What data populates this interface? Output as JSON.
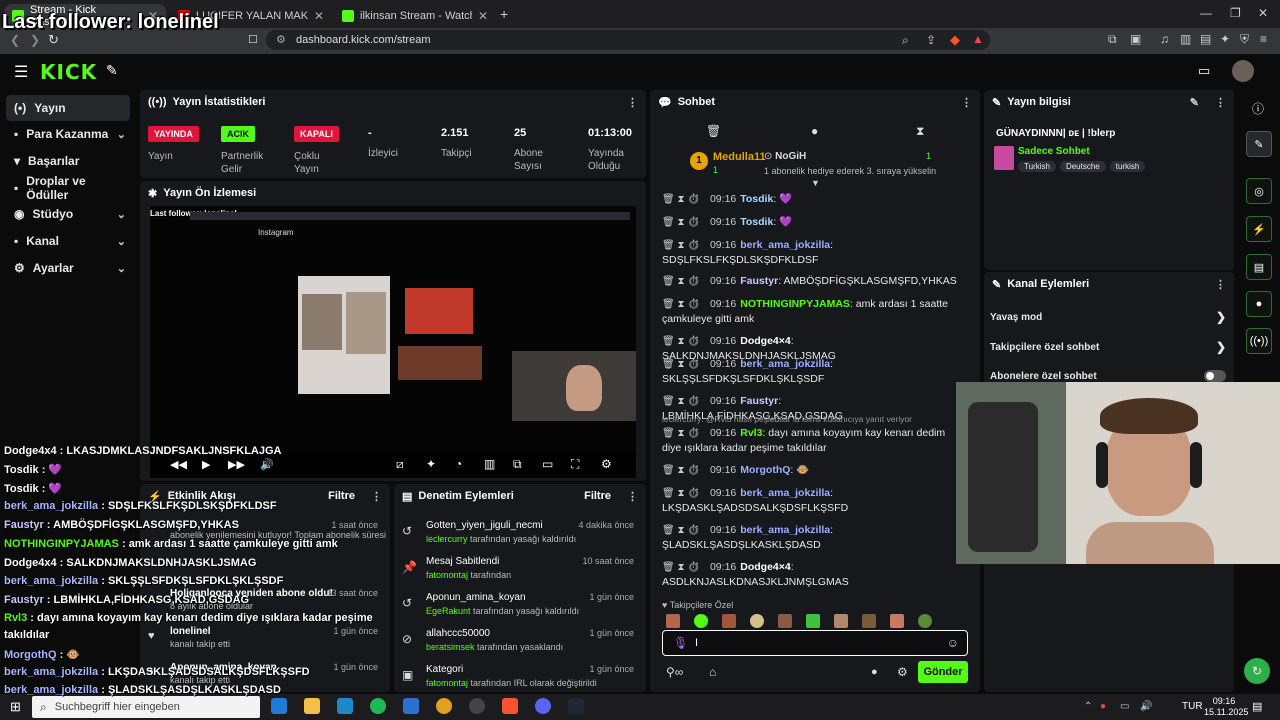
{
  "browser": {
    "tabs": [
      {
        "title": "Stream - Kick Dashboard",
        "active": true
      },
      {
        "title": "LUCIFER YALAN MAKİNESİNDE! | #Pe...",
        "active": false
      },
      {
        "title": "ilkinsan Stream - Watch Live on Kick",
        "active": false
      }
    ],
    "url": "dashboard.kick.com/stream"
  },
  "overlay": {
    "last_follower": "Last follower: lonelinel",
    "chat": [
      {
        "user": "Dodge4x4",
        "text": "LKASJDMKLASJNDFSAKLJNSFKLAJGA",
        "color": "#ffffff",
        "badge": ""
      },
      {
        "user": "Tosdik",
        "text": "💜",
        "color": "#ffffff",
        "badge": "1"
      },
      {
        "user": "Tosdik",
        "text": "💜",
        "color": "#ffffff",
        "badge": "1"
      },
      {
        "user": "berk_ama_jokzilla",
        "text": "SDŞLFKSLFKŞDLSKŞDFKLDSF",
        "color": "#a9b8ff",
        "badge": ""
      },
      {
        "user": "Faustyr",
        "text": "AMBÖŞDFİGŞKLASGMŞFD,YHKAS",
        "color": "#c9c9ff",
        "badge": ""
      },
      {
        "user": "NOTHINGINPYJAMAS",
        "text": "amk ardası 1 saatte çamkuleye gitti amk",
        "color": "#53fc18",
        "badge": ""
      },
      {
        "user": "Dodge4x4",
        "text": "SALKDNJMAKSLDNHJASKLJSMAG",
        "color": "#ffffff",
        "badge": ""
      },
      {
        "user": "berk_ama_jokzilla",
        "text": "SKLŞŞLSFDKŞLSFDKLŞKLŞSDF",
        "color": "#a9b8ff",
        "badge": ""
      },
      {
        "user": "Faustyr",
        "text": "LBMİHKLA,FİDHKASG,KSAD,GSDAG",
        "color": "#c9c9ff",
        "badge": ""
      },
      {
        "user": "Rvl3",
        "text": "dayı amına koyayım kay kenarı dedim diye ışıklara kadar peşime",
        "color": "#53fc18",
        "badge": ""
      },
      {
        "user": "",
        "text": "takıldılar",
        "color": "#ffffff",
        "badge": ""
      },
      {
        "user": "MorgothQ",
        "text": "🐵",
        "color": "#a9b8ff",
        "badge": ""
      },
      {
        "user": "berk_ama_jokzilla",
        "text": "LKŞDASKLŞADSDSALKŞDSFLKŞSFD",
        "color": "#a9b8ff",
        "badge": ""
      },
      {
        "user": "berk_ama_jokzilla",
        "text": "ŞLADSKLŞASDŞLKASKLŞDASD",
        "color": "#a9b8ff",
        "badge": ""
      }
    ]
  },
  "sidebar": {
    "items": [
      {
        "label": "Yayın",
        "icon": "•",
        "chevron": false,
        "active": true
      },
      {
        "label": "Para Kazanma",
        "icon": "▪",
        "chevron": true,
        "active": false
      },
      {
        "label": "Başarılar",
        "icon": "🏆",
        "chevron": false,
        "active": false
      },
      {
        "label": "Droplar ve Ödüller",
        "icon": "▪",
        "chevron": false,
        "active": false
      },
      {
        "label": "Stüdyo",
        "icon": "◉",
        "chevron": true,
        "active": false
      },
      {
        "label": "Kanal",
        "icon": "▪",
        "chevron": true,
        "active": false
      },
      {
        "label": "Ayarlar",
        "icon": "⚙",
        "chevron": true,
        "active": false
      }
    ]
  },
  "stats": {
    "title": "Yayın İstatistikleri",
    "items": [
      {
        "badge": "YAYINDA",
        "badge_color": "#e0143c",
        "label": "Yayın"
      },
      {
        "badge": "ACIK",
        "badge_color": "#53fc18",
        "label": "Partnerlik Gelir"
      },
      {
        "badge": "KAPALI",
        "badge_color": "#e0143c",
        "label": "Çoklu Yayın"
      },
      {
        "value": "-",
        "label": "İzleyici"
      },
      {
        "value": "2.151",
        "label": "Takipçi"
      },
      {
        "value": "25",
        "label": "Abone Sayısı"
      },
      {
        "value": "01:13:00",
        "label": "Yayında Olduğu"
      }
    ]
  },
  "preview": {
    "title": "Yayın Ön İzlemesi",
    "inner_follower": "Last follower: lonelinel"
  },
  "activity": {
    "title": "Etkinlik Akışı",
    "filter": "Filtre",
    "items": [
      {
        "title": "abonelik yenilemesini kutluyor! Toplam abonelik süresi",
        "sub": "",
        "time": "1 saat önce"
      },
      {
        "title": "Holiganlooca yeniden abone oldu!",
        "sub": "8 aylık abone oldular",
        "time": "13 saat önce"
      },
      {
        "title": "lonelinel",
        "sub": "kanalı takip etti",
        "time": "1 gün önce"
      },
      {
        "title": "Aponun_amina_koyan",
        "sub": "kanalı takip etti",
        "time": "1 gün önce"
      }
    ]
  },
  "moderation": {
    "title": "Denetim Eylemleri",
    "filter": "Filtre",
    "items": [
      {
        "icon": "↺",
        "title": "Gotten_yiyen_jiguli_necmi",
        "actor": "leclercurry",
        "action": "tarafından yasağı kaldırıldı",
        "time": "4 dakika önce"
      },
      {
        "icon": "📌",
        "title": "Mesaj Sabitlendi",
        "actor": "fatomontaj",
        "action": "tarafından",
        "time": "10 saat önce"
      },
      {
        "icon": "↺",
        "title": "Aponun_amina_koyan",
        "actor": "EgeRakunt",
        "action": "tarafından yasağı kaldırıldı",
        "time": "1 gün önce"
      },
      {
        "icon": "⊘",
        "title": "allahccc50000",
        "actor": "beratsimsek",
        "action": "tarafından yasaklandı",
        "time": "1 gün önce"
      },
      {
        "icon": "▣",
        "title": "Kategori",
        "actor": "fatomontaj",
        "action": "tarafından IRL olarak değiştirildi",
        "time": "1 gün önce"
      }
    ]
  },
  "chat": {
    "title": "Sohbet",
    "pinned": {
      "user": "Medulla11",
      "gift_user": "NoGiH",
      "gift_text": "1 abonelik hediye ederek 3. sıraya yükselin",
      "count": "1"
    },
    "reply_note": "leclercurry: @Rvl3 nasıl peşledilar la isimli kullanıcıya yanıt veriyor",
    "messages": [
      {
        "time": "09:16",
        "user": "Tosdik",
        "text": "💜",
        "color": "#a9d8ff"
      },
      {
        "time": "09:16",
        "user": "Tosdik",
        "text": "💜",
        "color": "#a9d8ff"
      },
      {
        "time": "09:16",
        "user": "berk_ama_jokzilla",
        "text": "SDŞLFKSLFKŞDLSKŞDFKLDSF",
        "color": "#9ab0ff"
      },
      {
        "time": "09:16",
        "user": "Faustyr",
        "text": "AMBÖŞDFİGŞKLASGMŞFD,YHKAS",
        "color": "#c9c9ff"
      },
      {
        "time": "09:16",
        "user": "NOTHINGINPYJAMAS",
        "text": "amk ardası 1 saatte çamkuleye gitti amk",
        "color": "#53fc18"
      },
      {
        "time": "09:16",
        "user": "Dodge4×4",
        "text": "SALKDNJMAKSLDNHJASKLJSMAG",
        "color": "#ffffff"
      },
      {
        "time": "09:16",
        "user": "berk_ama_jokzilla",
        "text": "SKLŞŞLSFDKŞLSFDKLŞKLŞSDF",
        "color": "#9ab0ff"
      },
      {
        "time": "09:16",
        "user": "Faustyr",
        "text": "LBMİHKLA,FİDHKASG,KSAD,GSDAG",
        "color": "#c9c9ff"
      },
      {
        "time": "09:16",
        "user": "Rvl3",
        "text": "dayı amına koyayım kay kenarı dedim diye ışıklara kadar peşime takıldılar",
        "color": "#53fc18"
      },
      {
        "time": "09:16",
        "user": "MorgothQ",
        "text": "🐵",
        "color": "#9ab0ff"
      },
      {
        "time": "09:16",
        "user": "berk_ama_jokzilla",
        "text": "LKŞDASKLŞADSDSALKŞDSFLKŞSFD",
        "color": "#9ab0ff"
      },
      {
        "time": "09:16",
        "user": "berk_ama_jokzilla",
        "text": "ŞLADSKLŞASDŞLKASKLŞDASD",
        "color": "#9ab0ff"
      },
      {
        "time": "09:16",
        "user": "Dodge4×4",
        "text": "ASDLKNJASLKDNASJKLJNMŞLGMAS",
        "color": "#ffffff"
      }
    ],
    "followers_only_label": "Takipçilere Özel",
    "input_value": "I",
    "send_label": "Gönder"
  },
  "stream_info": {
    "title": "Yayın bilgisi",
    "stream_title": "GÜNAYDINNN| ᴅᴇ | !blerp",
    "category": "Sadece Sohbet",
    "tags": [
      "Turkish",
      "Deutsche",
      "turkish"
    ]
  },
  "channel_actions": {
    "title": "Kanal Eylemleri",
    "items": [
      {
        "label": "Yavaş mod",
        "type": "chevron"
      },
      {
        "label": "Takipçilere özel sohbet",
        "type": "chevron"
      },
      {
        "label": "Abonelere özel sohbet",
        "type": "toggle"
      }
    ]
  },
  "taskbar": {
    "search_placeholder": "Suchbegriff hier eingeben",
    "lang": "TUR",
    "time": "09:16",
    "date": "15.11.2025"
  },
  "colors": {
    "brand": "#53fc18",
    "live": "#e0143c"
  }
}
